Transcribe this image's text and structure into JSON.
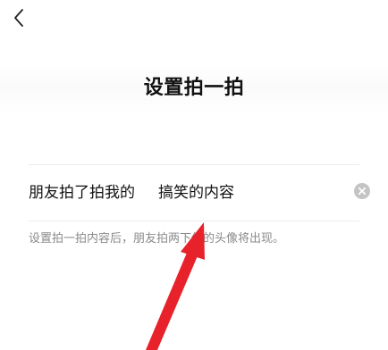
{
  "nav": {
    "back_icon": "chevron-left-icon"
  },
  "header": {
    "title": "设置拍一拍"
  },
  "pat_setting": {
    "prefix": "朋友拍了拍我的",
    "value": "搞笑的内容",
    "clear_icon": "clear-circle-icon",
    "hint": "设置拍一拍内容后，朋友拍两下你的头像将出现。"
  },
  "annotation": {
    "arrow_color": "#e8222a"
  }
}
